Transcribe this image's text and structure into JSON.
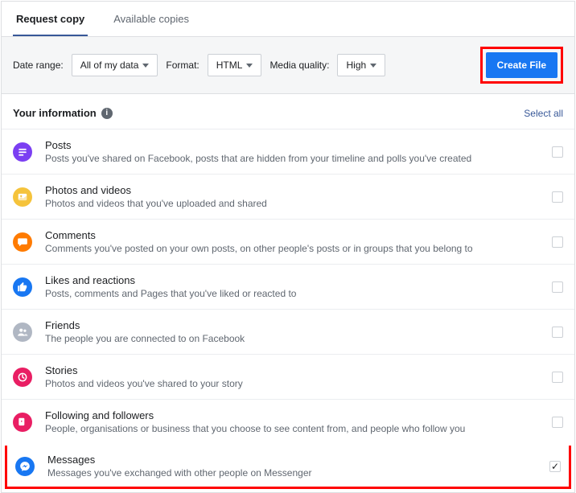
{
  "tabs": {
    "request": "Request copy",
    "available": "Available copies"
  },
  "controls": {
    "date_range_label": "Date range:",
    "date_range_value": "All of my data",
    "format_label": "Format:",
    "format_value": "HTML",
    "quality_label": "Media quality:",
    "quality_value": "High",
    "create_button": "Create File"
  },
  "section": {
    "title": "Your information",
    "select_all": "Select all"
  },
  "items": [
    {
      "title": "Posts",
      "desc": "Posts you've shared on Facebook, posts that are hidden from your timeline and polls you've created",
      "color": "#7b3ff2",
      "checked": false,
      "icon": "posts"
    },
    {
      "title": "Photos and videos",
      "desc": "Photos and videos that you've uploaded and shared",
      "color": "#f5c33b",
      "checked": false,
      "icon": "photos"
    },
    {
      "title": "Comments",
      "desc": "Comments you've posted on your own posts, on other people's posts or in groups that you belong to",
      "color": "#ff7b00",
      "checked": false,
      "icon": "comments"
    },
    {
      "title": "Likes and reactions",
      "desc": "Posts, comments and Pages that you've liked or reacted to",
      "color": "#1877f2",
      "checked": false,
      "icon": "like"
    },
    {
      "title": "Friends",
      "desc": "The people you are connected to on Facebook",
      "color": "#b0b7c3",
      "checked": false,
      "icon": "friends"
    },
    {
      "title": "Stories",
      "desc": "Photos and videos you've shared to your story",
      "color": "#e91e63",
      "checked": false,
      "icon": "stories"
    },
    {
      "title": "Following and followers",
      "desc": "People, organisations or business that you choose to see content from, and people who follow you",
      "color": "#e91e63",
      "checked": false,
      "icon": "following"
    },
    {
      "title": "Messages",
      "desc": "Messages you've exchanged with other people on Messenger",
      "color": "#1877f2",
      "checked": true,
      "icon": "messenger"
    }
  ]
}
